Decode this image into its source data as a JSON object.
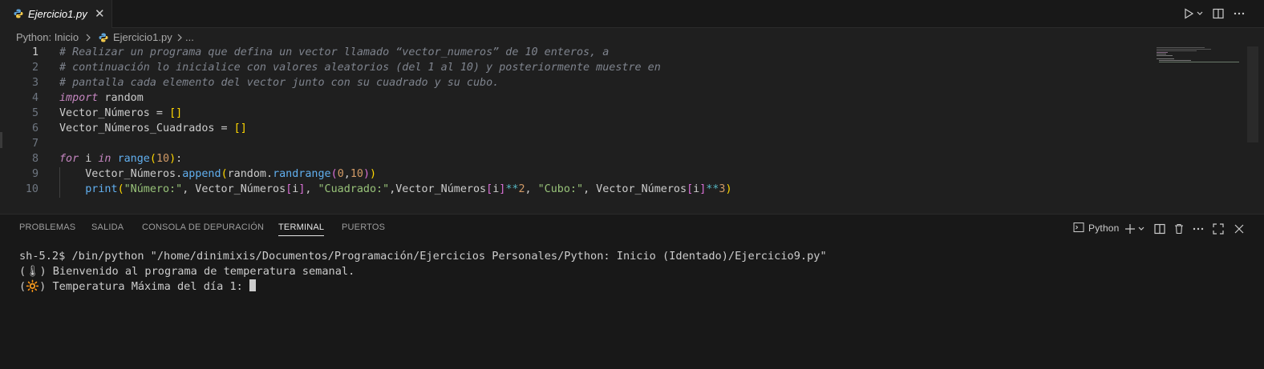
{
  "tab": {
    "label": "Ejercicio1.py",
    "close": "✕"
  },
  "breadcrumb": {
    "root": "Python: Inicio",
    "file": "Ejercicio1.py",
    "more": "..."
  },
  "editor": {
    "line_numbers": [
      "1",
      "2",
      "3",
      "4",
      "5",
      "6",
      "7",
      "8",
      "9",
      "10"
    ],
    "lines": [
      [
        {
          "t": "# Realizar un programa que defina un vector llamado “vector_numeros” de 10 enteros, a",
          "c": "cm"
        }
      ],
      [
        {
          "t": "# continuación lo inicialice con valores aleatorios (del 1 al 10) y posteriormente muestre en",
          "c": "cm"
        }
      ],
      [
        {
          "t": "# pantalla cada elemento del vector junto con su cuadrado y su cubo.",
          "c": "cm"
        }
      ],
      [
        {
          "t": "import",
          "c": "kw"
        },
        {
          "t": " random",
          "c": "var"
        }
      ],
      [
        {
          "t": "Vector_Números",
          "c": "var"
        },
        {
          "t": " = ",
          "c": "var"
        },
        {
          "t": "[]",
          "c": "br1"
        }
      ],
      [
        {
          "t": "Vector_Números_Cuadrados",
          "c": "var"
        },
        {
          "t": " = ",
          "c": "var"
        },
        {
          "t": "[]",
          "c": "br1"
        }
      ],
      [],
      [
        {
          "t": "for",
          "c": "kw"
        },
        {
          "t": " i ",
          "c": "var"
        },
        {
          "t": "in",
          "c": "kw"
        },
        {
          "t": " ",
          "c": "var"
        },
        {
          "t": "range",
          "c": "fn"
        },
        {
          "t": "(",
          "c": "br1"
        },
        {
          "t": "10",
          "c": "num"
        },
        {
          "t": ")",
          "c": "br1"
        },
        {
          "t": ":",
          "c": "var"
        }
      ],
      [
        {
          "t": "    Vector_Números.",
          "c": "var"
        },
        {
          "t": "append",
          "c": "fn"
        },
        {
          "t": "(",
          "c": "br1"
        },
        {
          "t": "random.",
          "c": "var"
        },
        {
          "t": "randrange",
          "c": "fn"
        },
        {
          "t": "(",
          "c": "br2"
        },
        {
          "t": "0",
          "c": "num"
        },
        {
          "t": ",",
          "c": "var"
        },
        {
          "t": "10",
          "c": "num"
        },
        {
          "t": ")",
          "c": "br2"
        },
        {
          "t": ")",
          "c": "br1"
        }
      ],
      [
        {
          "t": "    ",
          "c": "var"
        },
        {
          "t": "print",
          "c": "fn"
        },
        {
          "t": "(",
          "c": "br1"
        },
        {
          "t": "\"Número:\"",
          "c": "str"
        },
        {
          "t": ", Vector_Números",
          "c": "var"
        },
        {
          "t": "[",
          "c": "br2"
        },
        {
          "t": "i",
          "c": "var"
        },
        {
          "t": "]",
          "c": "br2"
        },
        {
          "t": ", ",
          "c": "var"
        },
        {
          "t": "\"Cuadrado:\"",
          "c": "str"
        },
        {
          "t": ",Vector_Números",
          "c": "var"
        },
        {
          "t": "[",
          "c": "br2"
        },
        {
          "t": "i",
          "c": "var"
        },
        {
          "t": "]",
          "c": "br2"
        },
        {
          "t": "**",
          "c": "op"
        },
        {
          "t": "2",
          "c": "num"
        },
        {
          "t": ", ",
          "c": "var"
        },
        {
          "t": "\"Cubo:\"",
          "c": "str"
        },
        {
          "t": ", Vector_Números",
          "c": "var"
        },
        {
          "t": "[",
          "c": "br2"
        },
        {
          "t": "i",
          "c": "var"
        },
        {
          "t": "]",
          "c": "br2"
        },
        {
          "t": "**",
          "c": "op"
        },
        {
          "t": "3",
          "c": "num"
        },
        {
          "t": ")",
          "c": "br1"
        }
      ]
    ]
  },
  "panel": {
    "tabs": [
      "PROBLEMAS",
      "SALIDA",
      "CONSOLA DE DEPURACIÓN",
      "TERMINAL",
      "PUERTOS"
    ],
    "active_tab": "TERMINAL",
    "terminal_name": "Python",
    "terminal_lines": [
      "sh-5.2$ /bin/python \"/home/dinimixis/Documentos/Programación/Ejercicios Personales/Python: Inicio (Identado)/Ejercicio9.py\"",
      "(🌡) Bienvenido al programa de temperatura semanal.",
      "(🔆) Temperatura Máxima del día 1: "
    ]
  },
  "colors": {
    "editor_bg": "#1f1f1f",
    "panel_bg": "#181818",
    "keyword": "#c586c0",
    "function": "#61afef",
    "string": "#98c379",
    "number": "#d19a66"
  }
}
